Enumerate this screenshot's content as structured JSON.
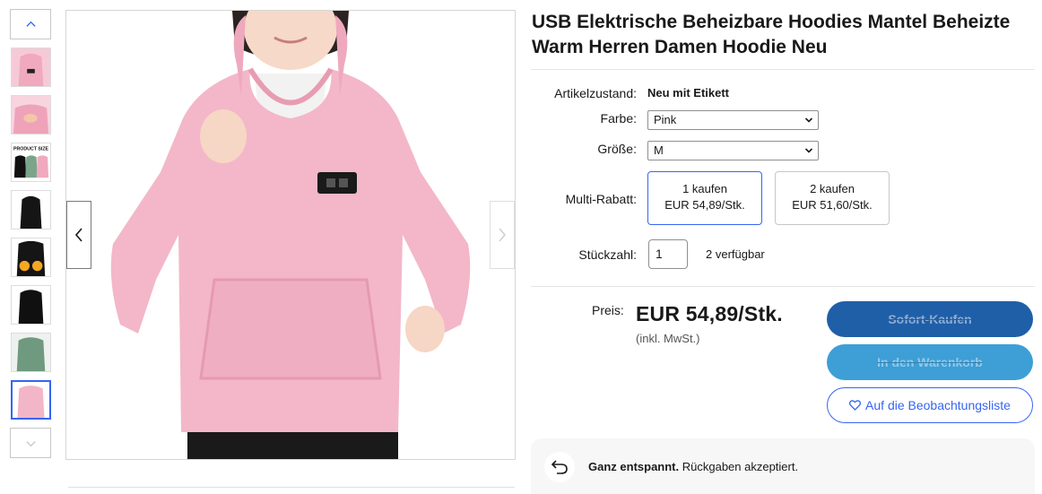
{
  "product": {
    "title": "USB Elektrische Beheizbare Hoodies Mantel Beheizte Warm Herren Damen Hoodie Neu"
  },
  "gallery": {
    "thumbnails": [
      {
        "name": "thumbnail-1",
        "alt": "pink hoodie front"
      },
      {
        "name": "thumbnail-2",
        "alt": "pink hoodie detail"
      },
      {
        "name": "thumbnail-3",
        "alt": "product size chart",
        "label": "PRODUCT SIZE"
      },
      {
        "name": "thumbnail-4",
        "alt": "black hoodie"
      },
      {
        "name": "thumbnail-5",
        "alt": "black hoodie heated pockets"
      },
      {
        "name": "thumbnail-6",
        "alt": "black hoodie side"
      },
      {
        "name": "thumbnail-7",
        "alt": "green hoodie"
      },
      {
        "name": "thumbnail-8",
        "alt": "pink hoodie",
        "selected": true
      }
    ]
  },
  "details": {
    "condition_label": "Artikelzustand:",
    "condition_value": "Neu mit Etikett",
    "color_label": "Farbe:",
    "color_value": "Pink",
    "size_label": "Größe:",
    "size_value": "M",
    "multibuy_label": "Multi-Rabatt:",
    "multibuy_options": [
      {
        "qty": "1 kaufen",
        "price": "EUR 54,89/Stk.",
        "selected": true
      },
      {
        "qty": "2 kaufen",
        "price": "EUR 51,60/Stk.",
        "selected": false
      }
    ],
    "quantity_label": "Stückzahl:",
    "quantity_value": "1",
    "available": "2 verfügbar"
  },
  "pricing": {
    "label": "Preis:",
    "value": "EUR 54,89/Stk.",
    "note": "(inkl. MwSt.)"
  },
  "actions": {
    "buy_now": "Sofort-Kaufen",
    "add_to_cart": "In den Warenkorb",
    "watchlist": "Auf die Beobachtungsliste"
  },
  "returns": {
    "bold": "Ganz entspannt.",
    "text": " Rückgaben akzeptiert."
  },
  "colors": {
    "accent": "#3665f3",
    "buy_button": "#1f5fa8",
    "cart_button": "#3d9fd6",
    "hoodie_pink": "#f3b5c8"
  }
}
